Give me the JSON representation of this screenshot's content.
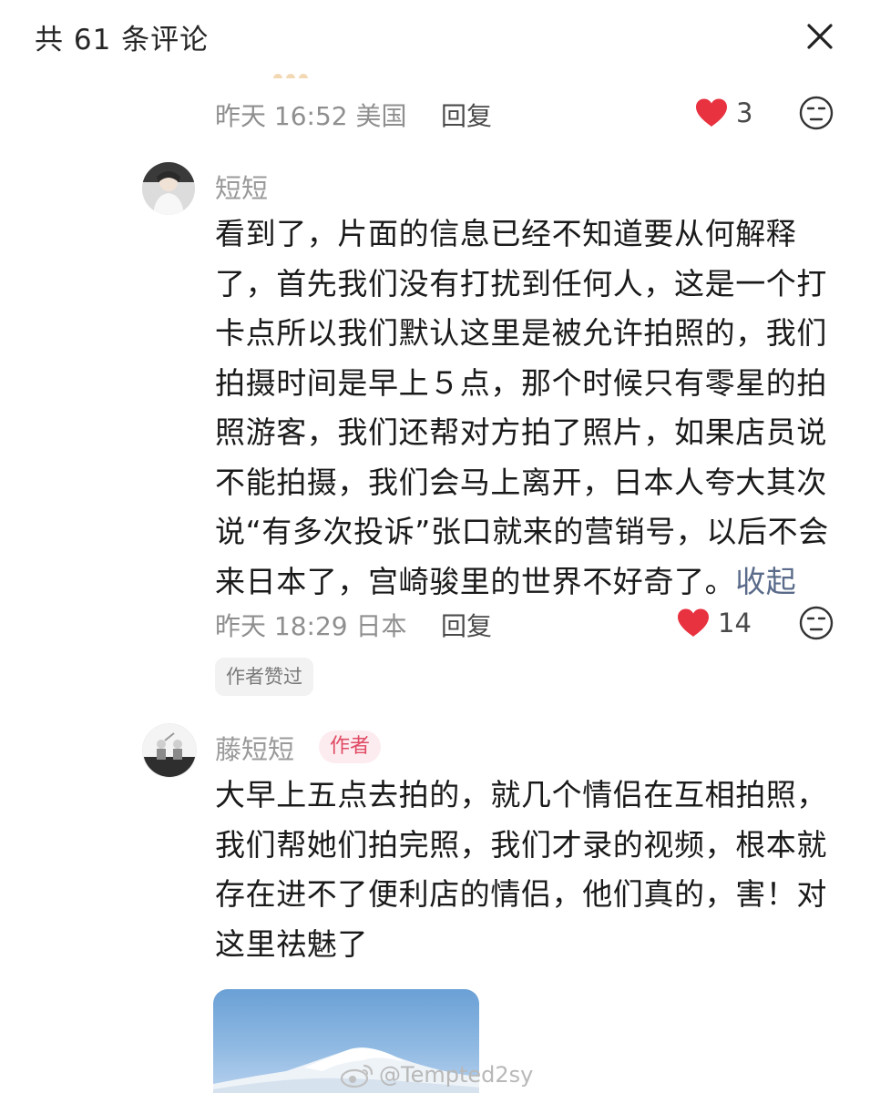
{
  "header": {
    "title": "共 61 条评论",
    "close_icon": "close-icon"
  },
  "comments": [
    {
      "meta": {
        "time_location": "昨天 16:52 美国",
        "reply_label": "回复",
        "like_count": "3"
      }
    },
    {
      "username": "短短",
      "text": "看到了，片面的信息已经不知道要从何解释了，首先我们没有打扰到任何人，这是一个打卡点所以我们默认这里是被允许拍照的，我们拍摄时间是早上５点，那个时候只有零星的拍照游客，我们还帮对方拍了照片，如果店员说不能拍摄，我们会马上离开，日本人夸大其次说“有多次投诉”张口就来的营销号，以后不会来日本了，宫崎骏里的世界不好奇了。",
      "collapse_label": "收起",
      "meta": {
        "time_location": "昨天 18:29 日本",
        "reply_label": "回复",
        "like_count": "14"
      },
      "liked_by_author": "作者赞过"
    },
    {
      "username": "藤短短",
      "badge": "作者",
      "text": "大早上五点去拍的，就几个情侣在互相拍照，我们帮她们拍完照，我们才录的视频，根本就存在进不了便利店的情侣，他们真的，害！对这里祛魅了"
    }
  ],
  "watermark": "@Tempted2sy",
  "colors": {
    "like_red": "#e8323f",
    "author_badge_text": "#e04a64",
    "author_badge_bg": "#fdecef"
  },
  "icons": [
    "close-icon",
    "heart-icon",
    "dislike-face-icon",
    "weibo-icon"
  ]
}
